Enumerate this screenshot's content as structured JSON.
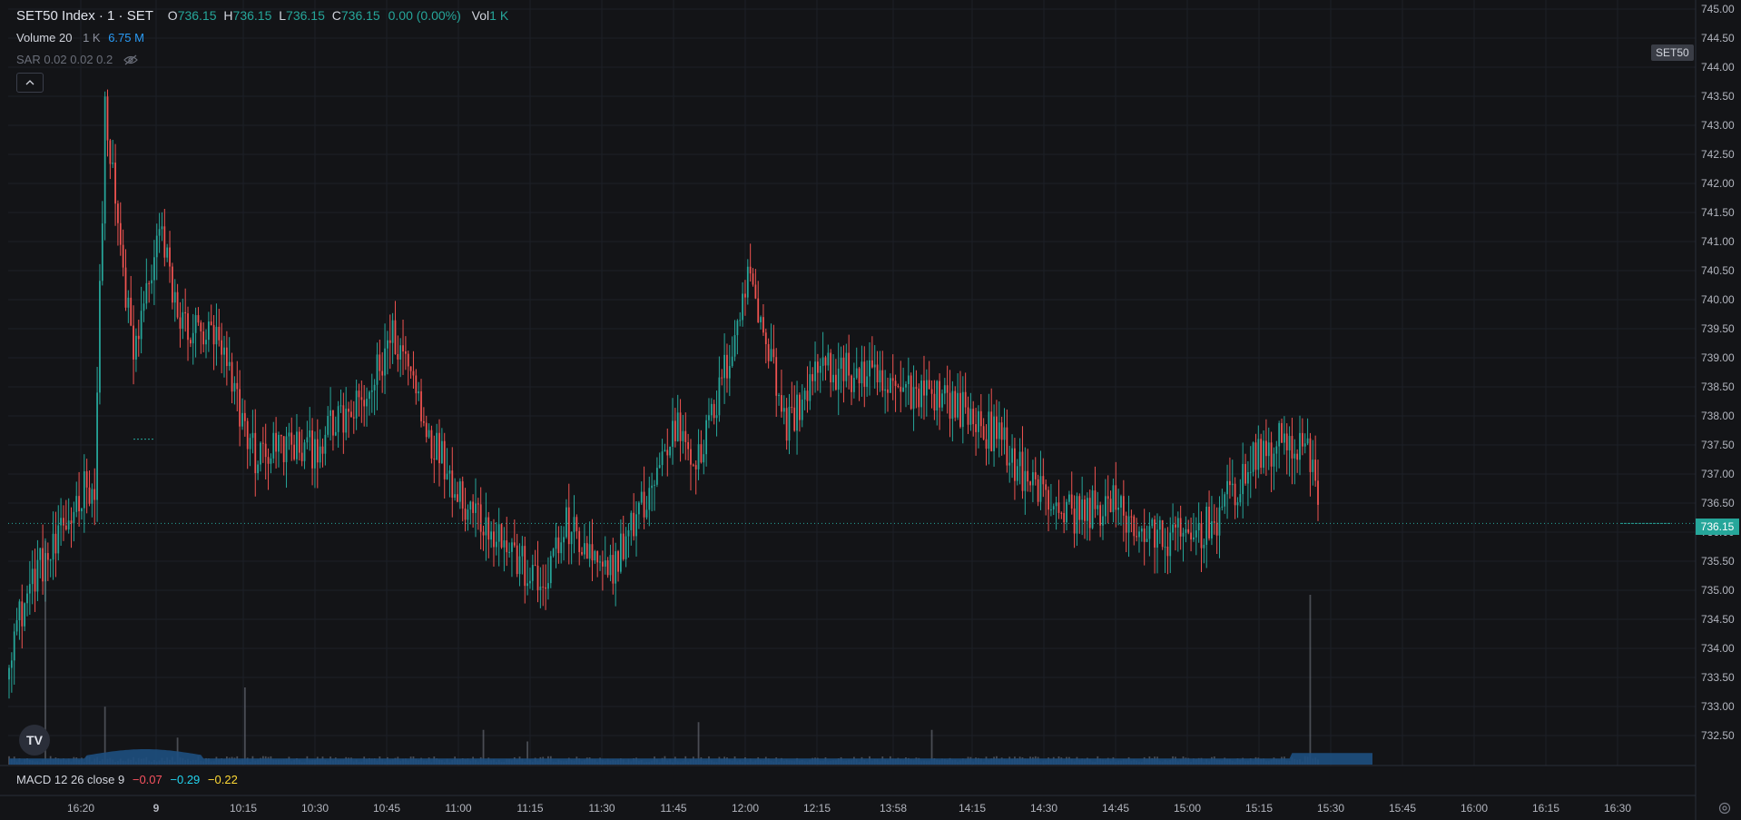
{
  "header": {
    "symbol": "SET50 Index · 1 · SET",
    "o_label": "O",
    "o_value": "736.15",
    "h_label": "H",
    "h_value": "736.15",
    "l_label": "L",
    "l_value": "736.15",
    "c_label": "C",
    "c_value": "736.15",
    "change": "0.00 (0.00%)",
    "vol_label": "Vol",
    "vol_value": "1 K"
  },
  "volume_indicator": {
    "name": "Volume 20",
    "value_a": "1 K",
    "value_b": "6.75 M"
  },
  "sar_indicator": {
    "name": "SAR 0.02 0.02 0.2",
    "icon": "eye-off-icon"
  },
  "macd": {
    "name": "MACD 12 26 close 9",
    "v1": "−0.07",
    "v2": "−0.29",
    "v3": "−0.22"
  },
  "symbol_tag": "SET50",
  "last_price": "736.15",
  "colors": {
    "bg": "#131417",
    "up": "#26a69a",
    "down": "#ef5350",
    "volume_ma": "#1e4f80",
    "grid": "#1d2027"
  },
  "chart_data": {
    "type": "candlestick",
    "y_ticks": [
      "745.00",
      "744.50",
      "744.00",
      "743.50",
      "743.00",
      "742.50",
      "742.00",
      "741.50",
      "741.00",
      "740.50",
      "740.00",
      "739.50",
      "739.00",
      "738.50",
      "738.00",
      "737.50",
      "737.00",
      "736.50",
      "736.00",
      "735.50",
      "735.00",
      "734.50",
      "734.00",
      "733.50",
      "733.00",
      "732.50"
    ],
    "ylim": [
      732.0,
      745.2
    ],
    "x_ticks": [
      "16:20",
      "9",
      "10:15",
      "10:30",
      "10:45",
      "11:00",
      "11:15",
      "11:30",
      "11:45",
      "12:00",
      "12:15",
      "13:58",
      "14:15",
      "14:30",
      "14:45",
      "15:00",
      "15:15",
      "15:30",
      "15:45",
      "16:00",
      "16:15",
      "16:30"
    ],
    "anchors": [
      [
        0,
        734.0
      ],
      [
        10,
        735.3
      ],
      [
        18,
        735.7
      ],
      [
        30,
        736.9
      ],
      [
        33,
        736.7
      ],
      [
        37,
        743.3
      ],
      [
        42,
        741.2
      ],
      [
        48,
        739.0
      ],
      [
        58,
        741.2
      ],
      [
        66,
        739.6
      ],
      [
        80,
        739.3
      ],
      [
        95,
        737.3
      ],
      [
        105,
        737.5
      ],
      [
        116,
        737.4
      ],
      [
        125,
        737.8
      ],
      [
        137,
        738.2
      ],
      [
        148,
        739.4
      ],
      [
        155,
        738.8
      ],
      [
        162,
        737.7
      ],
      [
        175,
        736.6
      ],
      [
        190,
        735.9
      ],
      [
        205,
        735.0
      ],
      [
        215,
        736.1
      ],
      [
        230,
        735.2
      ],
      [
        245,
        736.5
      ],
      [
        258,
        737.9
      ],
      [
        266,
        737.2
      ],
      [
        274,
        738.4
      ],
      [
        286,
        740.5
      ],
      [
        300,
        737.8
      ],
      [
        312,
        738.8
      ],
      [
        330,
        738.7
      ],
      [
        340,
        738.4
      ],
      [
        355,
        738.5
      ],
      [
        365,
        738.2
      ],
      [
        382,
        737.6
      ],
      [
        395,
        736.8
      ],
      [
        410,
        736.3
      ],
      [
        425,
        736.5
      ],
      [
        440,
        735.9
      ],
      [
        455,
        735.9
      ],
      [
        465,
        736.2
      ],
      [
        480,
        737.2
      ],
      [
        492,
        737.6
      ],
      [
        500,
        737.4
      ],
      [
        505,
        736.8
      ]
    ],
    "volume_spikes": [
      [
        14,
        2.9
      ],
      [
        37,
        0.75
      ],
      [
        65,
        0.35
      ],
      [
        91,
        1.0
      ],
      [
        183,
        0.45
      ],
      [
        200,
        0.3
      ],
      [
        266,
        0.55
      ],
      [
        356,
        0.45
      ],
      [
        502,
        2.2
      ]
    ],
    "session_breaks": [
      35,
      266
    ],
    "last_price": 736.15
  }
}
